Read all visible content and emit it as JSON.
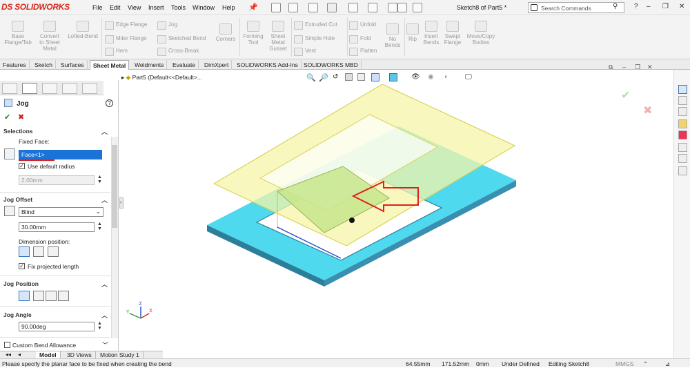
{
  "app": {
    "logo": "DS SOLIDWORKS",
    "menu": [
      "File",
      "Edit",
      "View",
      "Insert",
      "Tools",
      "Window",
      "Help"
    ],
    "doc_title": "Sketch8 of Part5 *",
    "search_placeholder": "Search Commands"
  },
  "ribbon": {
    "buttons": [
      {
        "label": "Base\nFlange/Tab"
      },
      {
        "label": "Convert\nto Sheet\nMetal"
      },
      {
        "label": "Lofted-Bend"
      },
      {
        "label": "Corners"
      },
      {
        "label": "Forming\nTool"
      },
      {
        "label": "Sheet\nMetal\nGusset"
      },
      {
        "label": "Unfold"
      },
      {
        "label": "Fold"
      },
      {
        "label": "Flatten"
      },
      {
        "label": "No\nBends"
      },
      {
        "label": "Rip"
      },
      {
        "label": "Insert\nBends"
      },
      {
        "label": "Swept\nFlange"
      },
      {
        "label": "Move/Copy\nBodies"
      }
    ],
    "small": [
      "Edge Flange",
      "Miter Flange",
      "Hem",
      "Jog",
      "Sketched Bend",
      "Cross-Break",
      "Extruded Cut",
      "Simple Hole",
      "Vent"
    ]
  },
  "tabs": [
    "Features",
    "Sketch",
    "Surfaces",
    "Sheet Metal",
    "Weldments",
    "Evaluate",
    "DimXpert",
    "SOLIDWORKS Add-Ins",
    "SOLIDWORKS MBD"
  ],
  "active_tab": "Sheet Metal",
  "tree": {
    "item": "Part5  (Default<<Default>..."
  },
  "panel": {
    "title": "Jog",
    "ok_icon": "check-icon",
    "cancel_icon": "x-icon",
    "selections": {
      "header": "Selections",
      "fixed_face_label": "Fixed Face:",
      "fixed_face_value": "Face<1>",
      "use_default_radius": "Use default radius",
      "use_default_radius_checked": true,
      "radius_value": "2.00mm"
    },
    "jog_offset": {
      "header": "Jog Offset",
      "end_condition": "Blind",
      "offset_value": "30.00mm",
      "dimension_position_label": "Dimension position:",
      "fix_projected_length": "Fix projected length",
      "fix_projected_checked": true
    },
    "jog_position": {
      "header": "Jog Position"
    },
    "jog_angle": {
      "header": "Jog Angle",
      "value": "90.00deg"
    },
    "custom_bend": {
      "label": "Custom Bend Allowance",
      "checked": false
    }
  },
  "bottom_tabs": [
    "Model",
    "3D Views",
    "Motion Study 1"
  ],
  "status": {
    "message": "Please specify the planar face to be fixed when creating the bend",
    "x": "64.55mm",
    "y": "171.52mm",
    "z": "0mm",
    "state": "Under Defined",
    "mode": "Editing Sketch8",
    "units": "MMGS"
  },
  "colors": {
    "part": "#56e4f0",
    "sketch_plane": "#f6f4a8",
    "arrow": "#e02020",
    "accent": "#d52b1e"
  }
}
